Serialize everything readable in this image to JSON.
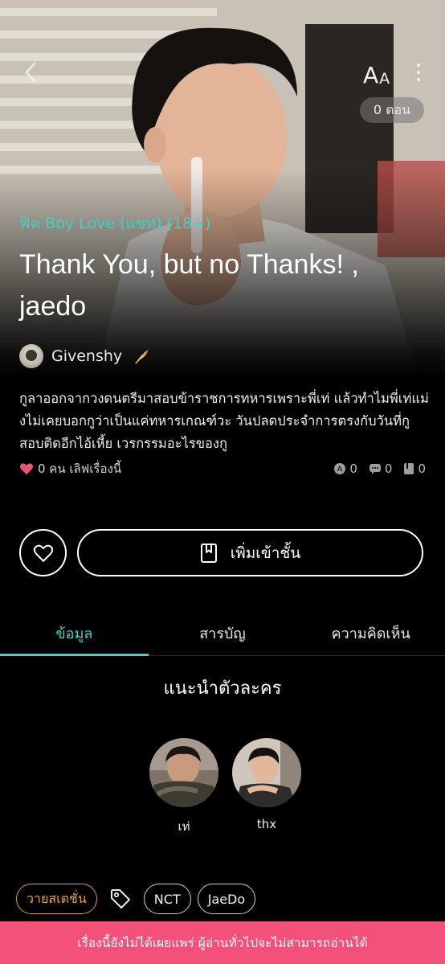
{
  "header": {
    "episode_count": "0 ตอน",
    "font_size_label_big": "A",
    "font_size_label_small": "A"
  },
  "story": {
    "genre": "ฟิค Boy Love (แชท) (18+)",
    "title": "Thank You, but no Thanks! , jaedo",
    "author": "Givenshy",
    "synopsis": "กูลาออกจากวงดนตรีมาสอบข้าราชการทหารเพราะพี่เท่ แล้วทำไมพี่เท่แม่งไม่เคยบอกกูว่าเป็นแค่ทหารเกณฑ์วะ วันปลดประจำการตรงกับวันที่กูสอบติดอีกไอ้เหี้ย เวรกรรมอะไรของกู",
    "likes_text": "0 คน เลิฟเรื่องนี้",
    "stat_a": "0",
    "stat_comments": "0",
    "stat_chapters": "0"
  },
  "actions": {
    "add_to_shelf": "เพิ่มเข้าชั้น"
  },
  "tabs": [
    {
      "label": "ข้อมูล",
      "active": true
    },
    {
      "label": "สารบัญ",
      "active": false
    },
    {
      "label": "ความคิดเห็น",
      "active": false
    }
  ],
  "characters_section": {
    "title": "แนะนำตัวละคร",
    "items": [
      {
        "name": "เท่"
      },
      {
        "name": "thx"
      }
    ]
  },
  "tags": {
    "status": "วายสเตชั่น",
    "items": [
      "NCT",
      "JaeDo"
    ]
  },
  "banner": {
    "text": "เรื่องนี้ยังไม่ได้เผยแพร่ ผู้อ่านทั่วไปจะไม่สามารถอ่านได้"
  },
  "colors": {
    "accent": "#3fd1c3",
    "like": "#f3507a",
    "banner": "#f3507a",
    "status_tag": "#e0a838",
    "background": "#000000"
  },
  "icons": [
    "chevron-left-icon",
    "more-vertical-icon",
    "feather-icon",
    "heart-icon",
    "book-icon",
    "tag-icon"
  ]
}
